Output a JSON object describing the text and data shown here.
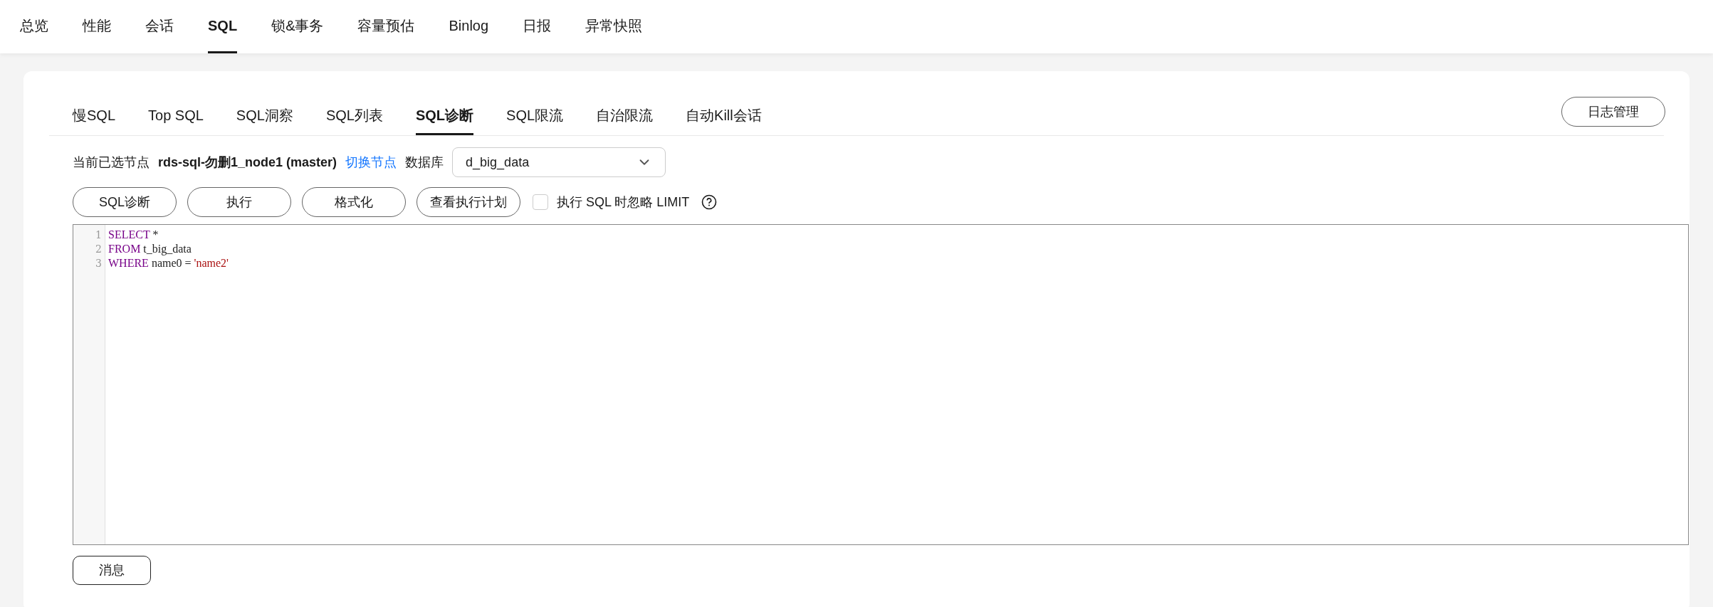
{
  "top_tabs": [
    {
      "label": "总览",
      "selected": false
    },
    {
      "label": "性能",
      "selected": false
    },
    {
      "label": "会话",
      "selected": false
    },
    {
      "label": "SQL",
      "selected": true
    },
    {
      "label": "锁&事务",
      "selected": false
    },
    {
      "label": "容量预估",
      "selected": false
    },
    {
      "label": "Binlog",
      "selected": false
    },
    {
      "label": "日报",
      "selected": false
    },
    {
      "label": "异常快照",
      "selected": false
    }
  ],
  "sub_tabs": [
    {
      "label": "慢SQL",
      "selected": false
    },
    {
      "label": "Top SQL",
      "selected": false
    },
    {
      "label": "SQL洞察",
      "selected": false
    },
    {
      "label": "SQL列表",
      "selected": false
    },
    {
      "label": "SQL诊断",
      "selected": true
    },
    {
      "label": "SQL限流",
      "selected": false
    },
    {
      "label": "自治限流",
      "selected": false
    },
    {
      "label": "自动Kill会话",
      "selected": false
    }
  ],
  "log_button": "日志管理",
  "node": {
    "label": "当前已选节点",
    "name": "rds-sql-勿删1_node1 (master)",
    "switch_link": "切换节点",
    "db_label": "数据库",
    "db_value": "d_big_data"
  },
  "actions": [
    "SQL诊断",
    "执行",
    "格式化",
    "查看执行计划"
  ],
  "ignore_limit": {
    "label": "执行 SQL 时忽略 LIMIT",
    "checked": false
  },
  "editor": {
    "lines": [
      {
        "number": "1",
        "tokens": [
          {
            "kind": "keyword",
            "text": "SELECT"
          },
          {
            "kind": "plain",
            "text": " *"
          }
        ]
      },
      {
        "number": "2",
        "tokens": [
          {
            "kind": "keyword",
            "text": "FROM"
          },
          {
            "kind": "plain",
            "text": " t_big_data"
          }
        ]
      },
      {
        "number": "3",
        "tokens": [
          {
            "kind": "keyword",
            "text": "WHERE"
          },
          {
            "kind": "plain",
            "text": " name0 = "
          },
          {
            "kind": "string",
            "text": "'name2'"
          }
        ]
      }
    ]
  },
  "message_button": "消息"
}
